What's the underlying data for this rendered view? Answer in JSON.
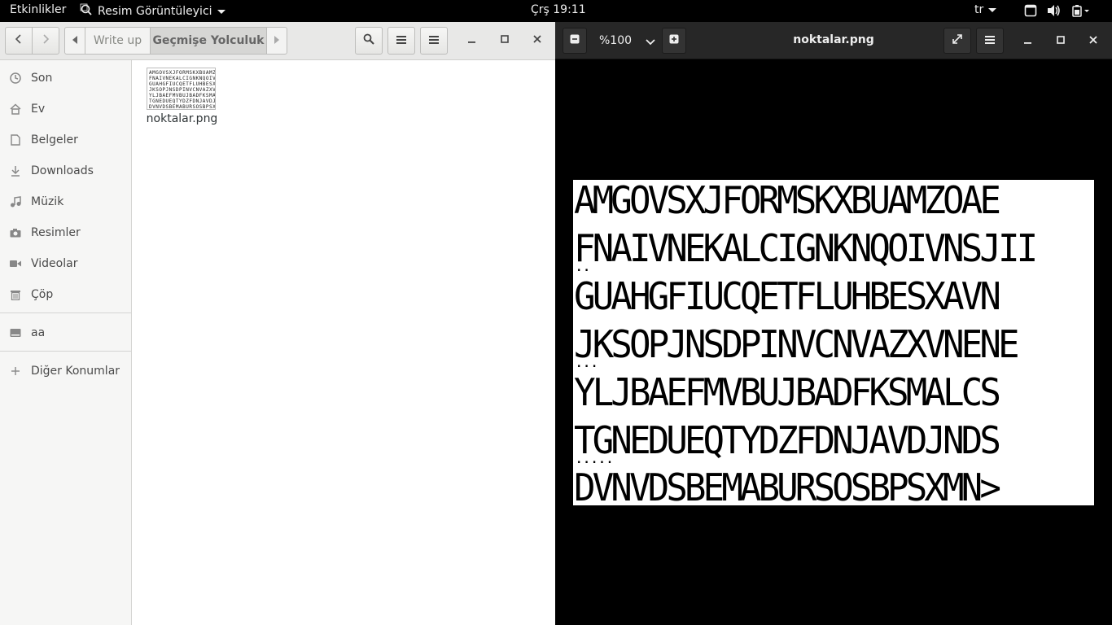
{
  "topbar": {
    "activities": "Etkinlikler",
    "app_name": "Resim Görüntüleyici",
    "clock": "Çrş 19:11",
    "language": "tr",
    "icons": [
      "window-icon",
      "volume-icon",
      "battery-icon"
    ]
  },
  "files": {
    "pathbar": {
      "segments": [
        "Write up",
        "Geçmişe Yolculuk"
      ]
    },
    "sidebar": {
      "items": [
        {
          "label": "Son",
          "icon": "clock-icon"
        },
        {
          "label": "Ev",
          "icon": "home-icon"
        },
        {
          "label": "Belgeler",
          "icon": "document-icon"
        },
        {
          "label": "Downloads",
          "icon": "download-icon"
        },
        {
          "label": "Müzik",
          "icon": "music-icon"
        },
        {
          "label": "Resimler",
          "icon": "camera-icon"
        },
        {
          "label": "Videolar",
          "icon": "video-icon"
        },
        {
          "label": "Çöp",
          "icon": "trash-icon"
        }
      ],
      "devices": [
        {
          "label": "aa",
          "icon": "drive-icon"
        }
      ],
      "other": {
        "label": "Diğer Konumlar",
        "icon": "plus-icon"
      }
    },
    "file": {
      "name": "noktalar.png"
    }
  },
  "viewer": {
    "zoom": "%100",
    "title": "noktalar.png",
    "image_rows": [
      "AMGOVSXJFORMSKXBUAMZOAE",
      "FNAIVNEKALCIGNKNQOIVNSJII",
      "GUAHGFIUCQETFLUHBESXAVN",
      "JKSOPJNSDPINVCNVAZXVNENE",
      "YLJBAEFMVBUJBADFKSMALCS",
      "TGNEDUEQTYDZFDNJAVDJNDS",
      "DVNVDSBEMABURSOSBPSXMN>"
    ],
    "dots_rows": [
      "..",
      "",
      "...",
      "",
      ".....",
      "",
      ""
    ]
  }
}
